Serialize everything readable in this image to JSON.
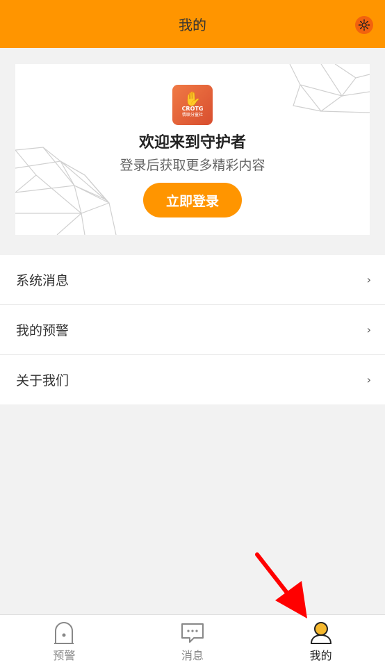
{
  "header": {
    "title": "我的"
  },
  "welcome": {
    "logo_text": "CROTG",
    "logo_sub": "情联分童社",
    "title": "欢迎来到守护者",
    "subtitle": "登录后获取更多精彩内容",
    "login_label": "立即登录"
  },
  "menu": {
    "items": [
      {
        "label": "系统消息"
      },
      {
        "label": "我的预警"
      },
      {
        "label": "关于我们"
      }
    ]
  },
  "tabbar": {
    "tabs": [
      {
        "label": "预警",
        "active": false
      },
      {
        "label": "消息",
        "active": false
      },
      {
        "label": "我的",
        "active": true
      }
    ]
  },
  "colors": {
    "accent": "#ff9500",
    "settings": "#f2620e",
    "arrow": "#ff0000"
  }
}
